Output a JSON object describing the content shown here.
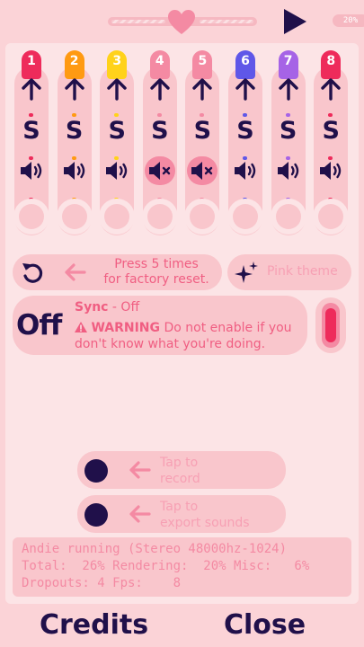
{
  "topbar": {
    "percent": "20%"
  },
  "channels": [
    {
      "num": "1",
      "color": "#ee2b5b",
      "dot": "#ee2b5b",
      "muted": false,
      "letter": "S"
    },
    {
      "num": "2",
      "color": "#ff9a12",
      "dot": "#ff9a12",
      "muted": false,
      "letter": "S"
    },
    {
      "num": "3",
      "color": "#ffd21b",
      "dot": "#ffd21b",
      "muted": false,
      "letter": "S"
    },
    {
      "num": "4",
      "color": "#f48aa3",
      "dot": "#f48aa3",
      "muted": true,
      "letter": "S"
    },
    {
      "num": "5",
      "color": "#f48aa3",
      "dot": "#f48aa3",
      "muted": true,
      "letter": "S"
    },
    {
      "num": "6",
      "color": "#5f57e8",
      "dot": "#5f57e8",
      "muted": false,
      "letter": "S"
    },
    {
      "num": "7",
      "color": "#a663e6",
      "dot": "#a663e6",
      "muted": false,
      "letter": "S"
    },
    {
      "num": "8",
      "color": "#ee2b5b",
      "dot": "#ee2b5b",
      "muted": false,
      "letter": "S"
    }
  ],
  "reset": {
    "line1": "Press 5 times",
    "line2": "for factory reset."
  },
  "theme": {
    "label": "Pink theme"
  },
  "sync": {
    "state": "Off",
    "title": "Sync",
    "status": " - Off",
    "warning_label": "WARNING",
    "warning_text1": " Do not enable if you",
    "warning_text2": "don't know what you're doing."
  },
  "record": {
    "line1": "Tap to",
    "line2": "record"
  },
  "export": {
    "line1": "Tap to",
    "line2": "export sounds"
  },
  "console": {
    "line1": "Andie running (Stereo 48000hz-1024)",
    "line2": "Total:  26% Rendering:  20% Misc:   6%",
    "line3": "Dropouts: 4 Fps:    8"
  },
  "footer": {
    "credits": "Credits",
    "close": "Close"
  },
  "colors": {
    "accent": "#f05e82",
    "dark": "#20104a",
    "background": "#fbd3d7"
  }
}
